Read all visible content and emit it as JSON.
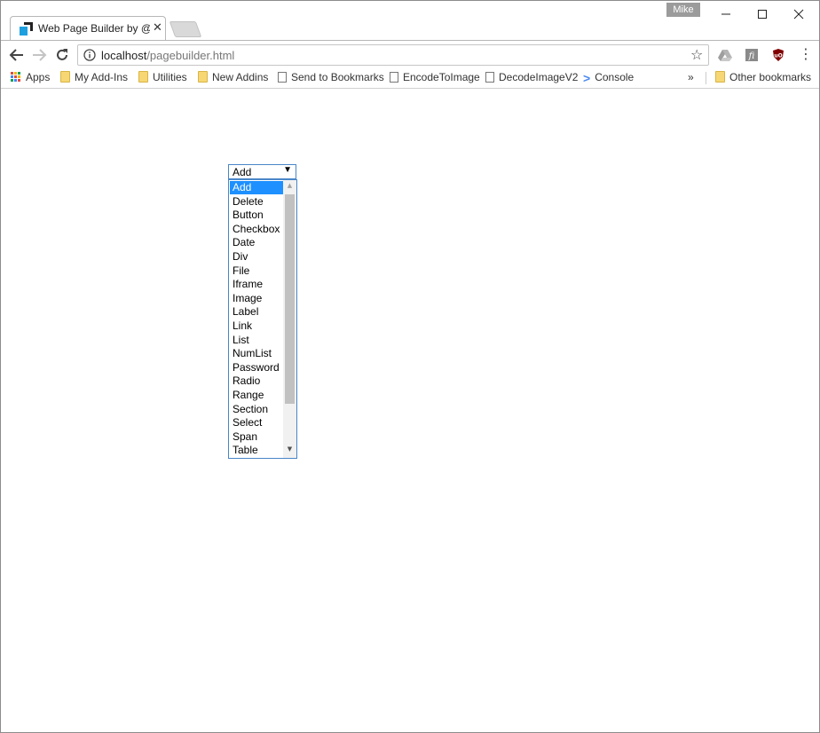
{
  "window": {
    "profile_name": "Mike",
    "controls": {
      "minimize": "—",
      "maximize": "☐",
      "close": "✕"
    }
  },
  "tab": {
    "title": "Web Page Builder by @m",
    "close_glyph": "✕"
  },
  "toolbar": {
    "url_host": "localhost",
    "url_path": "/pagebuilder.html",
    "star_glyph": "☆",
    "menu_glyph": "⋮"
  },
  "bookmarks": {
    "items": [
      {
        "label": "Apps",
        "icon": "apps-icon"
      },
      {
        "label": "My Add-Ins",
        "icon": "folder-icon"
      },
      {
        "label": "Utilities",
        "icon": "folder-icon"
      },
      {
        "label": "New Addins",
        "icon": "folder-icon"
      },
      {
        "label": "Send to Bookmarks",
        "icon": "page-icon"
      },
      {
        "label": "EncodeToImage",
        "icon": "page-icon"
      },
      {
        "label": "DecodeImageV2",
        "icon": "page-icon"
      },
      {
        "label": "Console",
        "icon": "chevron-right-icon"
      }
    ],
    "more_glyph": "»",
    "other_label": "Other bookmarks"
  },
  "select": {
    "value": "Add",
    "arrow_glyph": "▼",
    "options": [
      "Add",
      "Delete",
      "Button",
      "Checkbox",
      "Date",
      "Div",
      "File",
      "Iframe",
      "Image",
      "Label",
      "Link",
      "List",
      "NumList",
      "Password",
      "Radio",
      "Range",
      "Section",
      "Select",
      "Span",
      "Table"
    ]
  },
  "colors": {
    "selection": "#1e90ff",
    "focus_border": "#4a86c7",
    "scroll_thumb": "#c1c1c1"
  }
}
